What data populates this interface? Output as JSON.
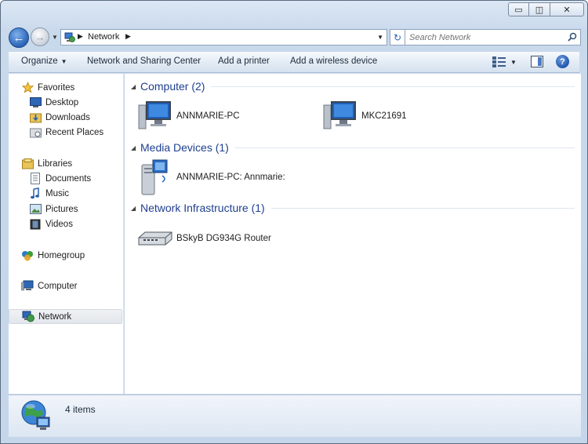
{
  "address": {
    "location": "Network"
  },
  "search": {
    "placeholder": "Search Network"
  },
  "caption_buttons": {
    "minimize": "▭",
    "maximize": "◫",
    "close": "✕"
  },
  "toolbar": {
    "organize": "Organize",
    "network_sharing": "Network and Sharing Center",
    "add_printer": "Add a printer",
    "add_wireless": "Add a wireless device"
  },
  "sidebar": {
    "favorites": "Favorites",
    "desktop": "Desktop",
    "downloads": "Downloads",
    "recent_places": "Recent Places",
    "libraries": "Libraries",
    "documents": "Documents",
    "music": "Music",
    "pictures": "Pictures",
    "videos": "Videos",
    "homegroup": "Homegroup",
    "computer": "Computer",
    "network": "Network"
  },
  "groups": {
    "computer": {
      "title": "Computer (2)",
      "items": [
        "ANNMARIE-PC",
        "MKC21691"
      ]
    },
    "media": {
      "title": "Media Devices (1)",
      "items": [
        "ANNMARIE-PC: Annmarie:"
      ]
    },
    "infra": {
      "title": "Network Infrastructure (1)",
      "items": [
        "BSkyB DG934G Router"
      ]
    }
  },
  "details": {
    "count": "4 items"
  },
  "icons": {
    "back": "arrow-left-icon",
    "forward": "arrow-right-icon",
    "refresh": "refresh-icon",
    "search": "magnifier-icon",
    "help": "question-icon"
  },
  "colors": {
    "accent": "#1e3f8f",
    "selection": "#e2e6eb"
  }
}
